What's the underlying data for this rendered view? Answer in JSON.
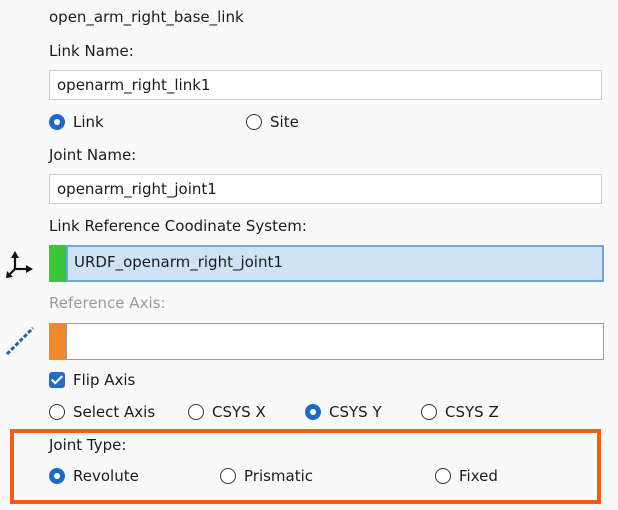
{
  "header": {
    "title": "open_arm_right_base_link"
  },
  "link": {
    "name_label": "Link Name:",
    "name_value": "openarm_right_link1",
    "type_options": [
      {
        "label": "Link",
        "checked": true
      },
      {
        "label": "Site",
        "checked": false
      }
    ]
  },
  "joint": {
    "name_label": "Joint Name:",
    "name_value": "openarm_right_joint1"
  },
  "reference_csys": {
    "label": "Link Reference Coodinate System:",
    "value": "URDF_openarm_right_joint1",
    "swatch_color": "#3cc43c",
    "icon": "coordinate-axes-icon"
  },
  "reference_axis": {
    "label": "Reference Axis:",
    "value": "",
    "swatch_color": "#f08a2a",
    "icon": "axis-line-icon",
    "flip_label": "Flip Axis",
    "flip_checked": true,
    "axis_options": [
      {
        "label": "Select Axis",
        "checked": false
      },
      {
        "label": "CSYS X",
        "checked": false
      },
      {
        "label": "CSYS Y",
        "checked": true
      },
      {
        "label": "CSYS Z",
        "checked": false
      }
    ]
  },
  "joint_type": {
    "label": "Joint Type:",
    "options": [
      {
        "label": "Revolute",
        "checked": true
      },
      {
        "label": "Prismatic",
        "checked": false
      },
      {
        "label": "Fixed",
        "checked": false
      }
    ],
    "highlight_color": "#f05a1a"
  },
  "colors": {
    "accent": "#1f6ac7",
    "selected_field_bg": "#cfe3f7",
    "selected_field_border": "#6ea6dd"
  }
}
